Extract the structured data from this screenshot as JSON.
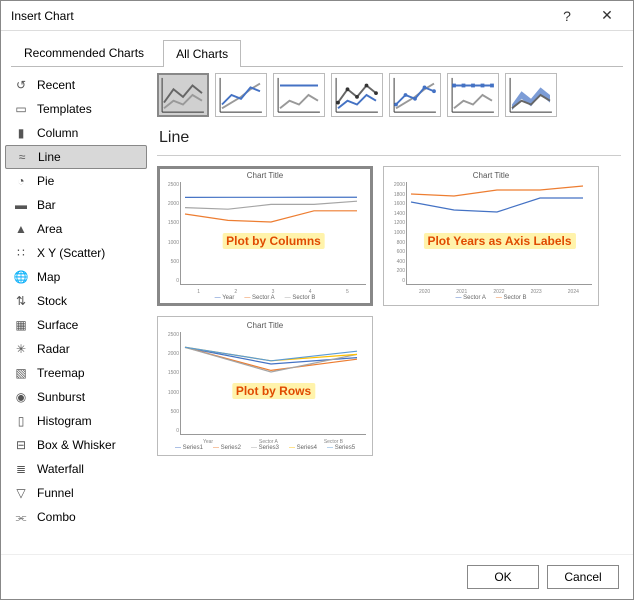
{
  "window": {
    "title": "Insert Chart",
    "help": "?",
    "close": "✕"
  },
  "tabs": {
    "recommended": "Recommended Charts",
    "all": "All Charts",
    "active": "all"
  },
  "sidebar": {
    "items": [
      {
        "label": "Recent",
        "icon": "recent-icon"
      },
      {
        "label": "Templates",
        "icon": "templates-icon"
      },
      {
        "label": "Column",
        "icon": "column-icon"
      },
      {
        "label": "Line",
        "icon": "line-icon",
        "selected": true
      },
      {
        "label": "Pie",
        "icon": "pie-icon"
      },
      {
        "label": "Bar",
        "icon": "bar-icon"
      },
      {
        "label": "Area",
        "icon": "area-icon"
      },
      {
        "label": "X Y (Scatter)",
        "icon": "scatter-icon"
      },
      {
        "label": "Map",
        "icon": "map-icon"
      },
      {
        "label": "Stock",
        "icon": "stock-icon"
      },
      {
        "label": "Surface",
        "icon": "surface-icon"
      },
      {
        "label": "Radar",
        "icon": "radar-icon"
      },
      {
        "label": "Treemap",
        "icon": "treemap-icon"
      },
      {
        "label": "Sunburst",
        "icon": "sunburst-icon"
      },
      {
        "label": "Histogram",
        "icon": "histogram-icon"
      },
      {
        "label": "Box & Whisker",
        "icon": "box-icon"
      },
      {
        "label": "Waterfall",
        "icon": "waterfall-icon"
      },
      {
        "label": "Funnel",
        "icon": "funnel-icon"
      },
      {
        "label": "Combo",
        "icon": "combo-icon"
      }
    ]
  },
  "main": {
    "heading": "Line",
    "subtypes": [
      "line",
      "stacked-line",
      "100-stacked-line",
      "line-markers",
      "stacked-line-markers",
      "100-stacked-line-markers",
      "3d-line"
    ],
    "selected_subtype": 0,
    "previews": [
      {
        "title": "Chart Title",
        "annot": "Plot by Columns",
        "selected": true,
        "legend": [
          "Year",
          "Sector A",
          "Sector B"
        ],
        "x": [
          "1",
          "2",
          "3",
          "4",
          "5"
        ]
      },
      {
        "title": "Chart Title",
        "annot": "Plot Years as Axis Labels",
        "legend": [
          "Sector A",
          "Sector B"
        ],
        "x": [
          "2020",
          "2021",
          "2022",
          "2023",
          "2024"
        ]
      },
      {
        "title": "Chart Title",
        "annot": "Plot by Rows",
        "legend": [
          "Series1",
          "Series2",
          "Series3",
          "Series4",
          "Series5"
        ],
        "x": [
          "Year",
          "Sector A",
          "Sector B"
        ]
      }
    ]
  },
  "buttons": {
    "ok": "OK",
    "cancel": "Cancel"
  },
  "chart_data": [
    {
      "type": "line",
      "title": "Chart Title",
      "role": "Plot by Columns",
      "categories": [
        "1",
        "2",
        "3",
        "4",
        "5"
      ],
      "series": [
        {
          "name": "Year",
          "values": [
            2020,
            2021,
            2022,
            2023,
            2024
          ]
        },
        {
          "name": "Sector A",
          "values": [
            1500,
            1300,
            1250,
            1600,
            1600
          ]
        },
        {
          "name": "Sector B",
          "values": [
            1700,
            1650,
            1800,
            1800,
            1900
          ]
        }
      ],
      "ylim": [
        0,
        2500
      ],
      "yticks": [
        0,
        500,
        1000,
        1500,
        2000,
        2500
      ]
    },
    {
      "type": "line",
      "title": "Chart Title",
      "role": "Plot Years as Axis Labels",
      "categories": [
        "2020",
        "2021",
        "2022",
        "2023",
        "2024"
      ],
      "series": [
        {
          "name": "Sector A",
          "values": [
            1500,
            1300,
            1250,
            1600,
            1600
          ]
        },
        {
          "name": "Sector B",
          "values": [
            1700,
            1650,
            1800,
            1800,
            1900
          ]
        }
      ],
      "ylim": [
        0,
        2000
      ],
      "yticks": [
        0,
        200,
        400,
        600,
        800,
        1000,
        1200,
        1400,
        1600,
        1800,
        2000
      ]
    },
    {
      "type": "line",
      "title": "Chart Title",
      "role": "Plot by Rows",
      "categories": [
        "Year",
        "Sector A",
        "Sector B"
      ],
      "series": [
        {
          "name": "Series1",
          "values": [
            2020,
            1500,
            1700
          ]
        },
        {
          "name": "Series2",
          "values": [
            2021,
            1300,
            1650
          ]
        },
        {
          "name": "Series3",
          "values": [
            2022,
            1250,
            1800
          ]
        },
        {
          "name": "Series4",
          "values": [
            2023,
            1600,
            1800
          ]
        },
        {
          "name": "Series5",
          "values": [
            2024,
            1600,
            1900
          ]
        }
      ],
      "ylim": [
        0,
        2500
      ],
      "yticks": [
        0,
        500,
        1000,
        1500,
        2000,
        2500
      ]
    }
  ]
}
